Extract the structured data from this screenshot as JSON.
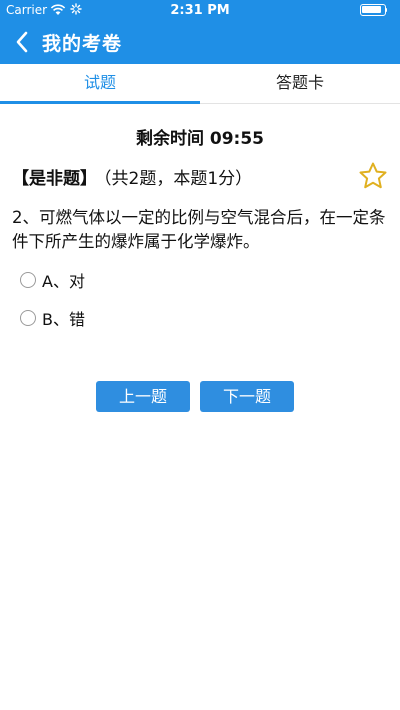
{
  "status_bar": {
    "carrier": "Carrier",
    "time": "2:31 PM"
  },
  "nav": {
    "back_icon": "chevron-left-icon",
    "title": "我的考卷"
  },
  "tabs": [
    {
      "label": "试题",
      "active": true
    },
    {
      "label": "答题卡",
      "active": false
    }
  ],
  "timer": "剩余时间 09:55",
  "question": {
    "type_label": "【是非题】",
    "info": "（共2题，本题1分）",
    "text": "2、可燃气体以一定的比例与空气混合后，在一定条件下所产生的爆炸属于化学爆炸。",
    "options": [
      {
        "label": "A、对"
      },
      {
        "label": "B、错"
      }
    ]
  },
  "buttons": {
    "prev": "上一题",
    "next": "下一题"
  },
  "colors": {
    "primary": "#1f8fe6",
    "button": "#2f8ee0",
    "star": "#e0b020"
  }
}
